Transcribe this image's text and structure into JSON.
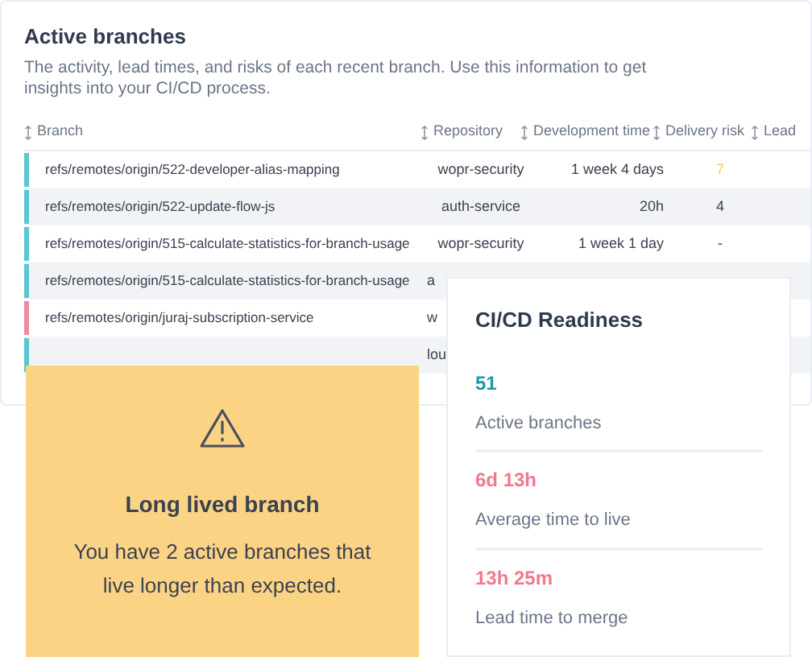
{
  "title": "Active branches",
  "description": "The activity, lead times, and risks of each recent branch. Use this information to get insights into your CI/CD process.",
  "table": {
    "columns": [
      "Branch",
      "Repository",
      "Development time",
      "Delivery risk",
      "Lead"
    ],
    "rows": [
      {
        "branch": "refs/remotes/origin/522-developer-alias-mapping",
        "repository": "wopr-security",
        "development_time": "1 week 4 days",
        "delivery_risk": "7",
        "risk_highlight": true,
        "color": "#5ac8d0"
      },
      {
        "branch": "refs/remotes/origin/522-update-flow-js",
        "repository": "auth-service",
        "development_time": "20h",
        "delivery_risk": "4",
        "risk_highlight": false,
        "color": "#5ac8d0"
      },
      {
        "branch": "refs/remotes/origin/515-calculate-statistics-for-branch-usage",
        "repository": "wopr-security",
        "development_time": "1 week 1 day",
        "delivery_risk": "-",
        "risk_highlight": false,
        "color": "#5ac8d0"
      },
      {
        "branch": "refs/remotes/origin/515-calculate-statistics-for-branch-usage",
        "repository": "a",
        "color": "#5ac8d0"
      },
      {
        "branch": "refs/remotes/origin/juraj-subscription-service",
        "repository": "w",
        "color": "#f08a9a"
      },
      {
        "repository": "lou",
        "color": "#5ac8d0"
      }
    ]
  },
  "alert": {
    "title": "Long lived branch",
    "message": "You have 2 active branches that live longer than expected."
  },
  "readiness": {
    "title": "CI/CD Readiness",
    "metrics": [
      {
        "value": "51",
        "label": "Active branches",
        "color": "#1a9aad"
      },
      {
        "value": "6d 13h",
        "label": "Average time to live",
        "color": "#f07a8c"
      },
      {
        "value": "13h 25m",
        "label": "Lead time to merge",
        "color": "#f07a8c"
      }
    ]
  }
}
